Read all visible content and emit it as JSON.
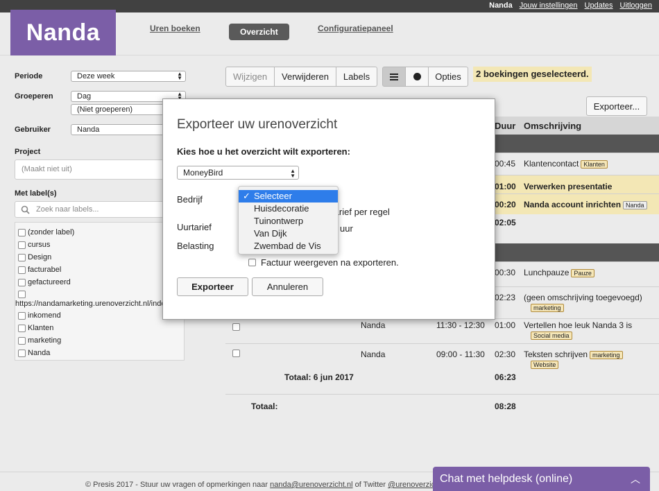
{
  "topbar": {
    "user": "Nanda",
    "settings": "Jouw instellingen",
    "updates": "Updates",
    "logout": "Uitloggen"
  },
  "logo": "Nanda",
  "nav": {
    "hours": "Uren boeken",
    "overview": "Overzicht",
    "config": "Configuratiepaneel"
  },
  "sidebar": {
    "period_label": "Periode",
    "period_value": "Deze week",
    "group_label": "Groeperen",
    "group_value": "Dag",
    "group_value2": "(Niet groeperen)",
    "user_label": "Gebruiker",
    "user_value": "Nanda",
    "project_label": "Project",
    "project_placeholder": "(Maakt niet uit)",
    "labels_label": "Met label(s)",
    "labels_search_placeholder": "Zoek naar labels...",
    "labels": [
      "(zonder label)",
      "cursus",
      "Design",
      "facturabel",
      "gefactureerd",
      "https://nandamarketing.urenoverzicht.nl/index",
      "inkomend",
      "Klanten",
      "marketing",
      "Nanda"
    ]
  },
  "toolbar": {
    "edit": "Wijzigen",
    "delete": "Verwijderen",
    "labels": "Labels",
    "options": "Opties",
    "selected": "2 boekingen geselecteerd.",
    "export": "Exporteer..."
  },
  "table": {
    "col_duration": "Duur",
    "col_description": "Omschrijving",
    "rows": [
      {
        "duration": "00:45",
        "desc": "Klantencontact",
        "tag": "Klanten"
      },
      {
        "duration": "01:00",
        "desc": "Verwerken presentatie"
      },
      {
        "duration": "00:20",
        "desc": "Nanda account inrichten",
        "tag": "Nanda"
      },
      {
        "duration": "02:05"
      },
      {
        "duration": "00:30",
        "desc": "Lunchpauze",
        "tag": "Pauze"
      },
      {
        "duration": "02:23",
        "desc": "(geen omschrijving toegevoegd)",
        "tag": "marketing"
      },
      {
        "user": "Nanda",
        "time": "11:30 - 12:30",
        "duration": "01:00",
        "desc": "Vertellen hoe leuk Nanda 3 is",
        "tag": "Social media"
      },
      {
        "user": "Nanda",
        "time": "09:00 - 11:30",
        "duration": "02:30",
        "desc": "Teksten schrijven",
        "tag": "marketing",
        "tag2": "Website"
      }
    ],
    "day_total_label": "Totaal: 6 jun 2017",
    "day_total": "06:23",
    "total_label": "Totaal:",
    "total": "08:28"
  },
  "modal": {
    "title": "Exporteer uw urenoverzicht",
    "question": "Kies hoe u het overzicht wilt exporteren:",
    "format": "MoneyBird",
    "company_label": "Bedrijf",
    "rate_per_line_tail": "en tarief per regel",
    "hourly_label": "Uurtarief",
    "hourly_tail": "uur",
    "tax_label": "Belasting",
    "show_invoice": "Factuur weergeven na exporteren.",
    "export_button": "Exporteer",
    "cancel_button": "Annuleren",
    "company_options": [
      "Selecteer",
      "Huisdecoratie",
      "Tuinontwerp",
      "Van Dijk",
      "Zwembad de Vis"
    ],
    "check_glyph": "✓"
  },
  "footer": {
    "text_pre": "© Presis 2017 - Stuur uw vragen of opmerkingen naar ",
    "email": "nanda@urenoverzicht.nl",
    "text_mid": " of Twitter ",
    "twitter": "@urenoverzicht"
  },
  "chat": {
    "label": "Chat met helpdesk (online)"
  },
  "colors": {
    "brand": "#7b5ea7",
    "highlight": "#f3e7b5",
    "selected_option": "#2e7dea"
  }
}
